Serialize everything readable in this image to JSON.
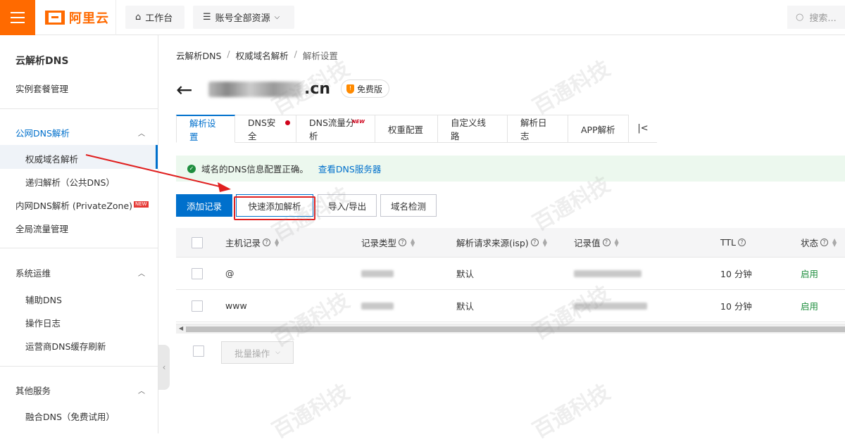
{
  "topbar": {
    "logo_text": "阿里云",
    "workbench_label": "工作台",
    "resources_label": "账号全部资源",
    "search_placeholder": "搜索..."
  },
  "sidebar": {
    "title": "云解析DNS",
    "instance_label": "实例套餐管理",
    "groups": [
      {
        "label": "公网DNS解析",
        "items": [
          "权威域名解析",
          "递归解析（公共DNS）"
        ]
      },
      {
        "label": "系统运维",
        "items": [
          "辅助DNS",
          "操作日志",
          "运营商DNS缓存刷新"
        ]
      },
      {
        "label": "其他服务",
        "items": [
          "融合DNS（免费试用）"
        ]
      }
    ],
    "private_zone_label": "内网DNS解析 (PrivateZone)",
    "private_zone_new": "NEW",
    "global_traffic_label": "全局流量管理"
  },
  "breadcrumb": [
    "云解析DNS",
    "权威域名解析",
    "解析设置"
  ],
  "domain": {
    "suffix": ".cn",
    "badge": "免费版"
  },
  "tabs": [
    {
      "label": "解析设置",
      "active": true
    },
    {
      "label": "DNS安全",
      "dot": true
    },
    {
      "label": "DNS流量分析",
      "new": "NEW"
    },
    {
      "label": "权重配置"
    },
    {
      "label": "自定义线路"
    },
    {
      "label": "解析日志"
    },
    {
      "label": "APP解析"
    }
  ],
  "tab_more_icon": "|<",
  "notice": {
    "text": "域名的DNS信息配置正确。",
    "link": "查看DNS服务器"
  },
  "toolbar": {
    "add_record": "添加记录",
    "quick_add": "快速添加解析",
    "import_export": "导入/导出",
    "domain_check": "域名检测"
  },
  "table": {
    "columns": [
      "主机记录",
      "记录类型",
      "解析请求来源(isp)",
      "记录值",
      "TTL",
      "状态"
    ],
    "rows": [
      {
        "host": "@",
        "isp": "默认",
        "ttl": "10 分钟",
        "status": "启用"
      },
      {
        "host": "www",
        "isp": "默认",
        "ttl": "10 分钟",
        "status": "启用"
      }
    ]
  },
  "batch_label": "批量操作",
  "watermark": "百通科技",
  "colors": {
    "brand": "#ff6a00",
    "primary": "#0070cc",
    "success": "#1e8e3e",
    "annotation": "#e02020"
  }
}
